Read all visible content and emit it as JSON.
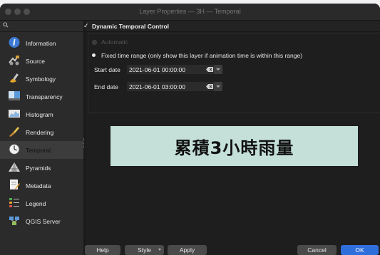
{
  "window": {
    "title": "Layer Properties — 3H — Temporal"
  },
  "sidebar": {
    "items": [
      {
        "label": "Information",
        "icon": "information-icon",
        "active": false
      },
      {
        "label": "Source",
        "icon": "source-icon",
        "active": false
      },
      {
        "label": "Symbology",
        "icon": "symbology-icon",
        "active": false
      },
      {
        "label": "Transparency",
        "icon": "transparency-icon",
        "active": false
      },
      {
        "label": "Histogram",
        "icon": "histogram-icon",
        "active": false
      },
      {
        "label": "Rendering",
        "icon": "rendering-icon",
        "active": false
      },
      {
        "label": "Temporal",
        "icon": "temporal-clock-icon",
        "active": true
      },
      {
        "label": "Pyramids",
        "icon": "pyramids-icon",
        "active": false
      },
      {
        "label": "Metadata",
        "icon": "metadata-icon",
        "active": false
      },
      {
        "label": "Legend",
        "icon": "legend-icon",
        "active": false
      },
      {
        "label": "QGIS Server",
        "icon": "qgis-server-icon",
        "active": false
      }
    ]
  },
  "temporal": {
    "section_title": "Dynamic Temporal Control",
    "section_checked": true,
    "option_automatic": "Automatic",
    "option_fixed": "Fixed time range (only show this layer if animation time is within this range)",
    "selected_option": "fixed",
    "start_label": "Start date",
    "start_value": "2021-06-01 00:00:00",
    "end_label": "End date",
    "end_value": "2021-06-01 03:00:00"
  },
  "overlay": {
    "text": "累積3小時雨量",
    "background": "#c4e0d9"
  },
  "buttons": {
    "help": "Help",
    "style": "Style",
    "apply": "Apply",
    "cancel": "Cancel",
    "ok": "OK"
  },
  "colors": {
    "accent": "#2f6fdc",
    "sidebar_bg": "#2b2b2b",
    "active_item_bg": "#3c3c3c"
  }
}
